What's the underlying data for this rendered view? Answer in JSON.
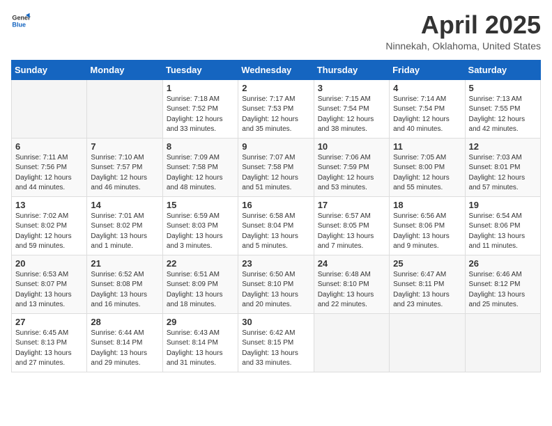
{
  "logo": {
    "general": "General",
    "blue": "Blue"
  },
  "title": "April 2025",
  "subtitle": "Ninnekah, Oklahoma, United States",
  "days_of_week": [
    "Sunday",
    "Monday",
    "Tuesday",
    "Wednesday",
    "Thursday",
    "Friday",
    "Saturday"
  ],
  "weeks": [
    [
      {
        "day": "",
        "info": ""
      },
      {
        "day": "",
        "info": ""
      },
      {
        "day": "1",
        "info": "Sunrise: 7:18 AM\nSunset: 7:52 PM\nDaylight: 12 hours and 33 minutes."
      },
      {
        "day": "2",
        "info": "Sunrise: 7:17 AM\nSunset: 7:53 PM\nDaylight: 12 hours and 35 minutes."
      },
      {
        "day": "3",
        "info": "Sunrise: 7:15 AM\nSunset: 7:54 PM\nDaylight: 12 hours and 38 minutes."
      },
      {
        "day": "4",
        "info": "Sunrise: 7:14 AM\nSunset: 7:54 PM\nDaylight: 12 hours and 40 minutes."
      },
      {
        "day": "5",
        "info": "Sunrise: 7:13 AM\nSunset: 7:55 PM\nDaylight: 12 hours and 42 minutes."
      }
    ],
    [
      {
        "day": "6",
        "info": "Sunrise: 7:11 AM\nSunset: 7:56 PM\nDaylight: 12 hours and 44 minutes."
      },
      {
        "day": "7",
        "info": "Sunrise: 7:10 AM\nSunset: 7:57 PM\nDaylight: 12 hours and 46 minutes."
      },
      {
        "day": "8",
        "info": "Sunrise: 7:09 AM\nSunset: 7:58 PM\nDaylight: 12 hours and 48 minutes."
      },
      {
        "day": "9",
        "info": "Sunrise: 7:07 AM\nSunset: 7:58 PM\nDaylight: 12 hours and 51 minutes."
      },
      {
        "day": "10",
        "info": "Sunrise: 7:06 AM\nSunset: 7:59 PM\nDaylight: 12 hours and 53 minutes."
      },
      {
        "day": "11",
        "info": "Sunrise: 7:05 AM\nSunset: 8:00 PM\nDaylight: 12 hours and 55 minutes."
      },
      {
        "day": "12",
        "info": "Sunrise: 7:03 AM\nSunset: 8:01 PM\nDaylight: 12 hours and 57 minutes."
      }
    ],
    [
      {
        "day": "13",
        "info": "Sunrise: 7:02 AM\nSunset: 8:02 PM\nDaylight: 12 hours and 59 minutes."
      },
      {
        "day": "14",
        "info": "Sunrise: 7:01 AM\nSunset: 8:02 PM\nDaylight: 13 hours and 1 minute."
      },
      {
        "day": "15",
        "info": "Sunrise: 6:59 AM\nSunset: 8:03 PM\nDaylight: 13 hours and 3 minutes."
      },
      {
        "day": "16",
        "info": "Sunrise: 6:58 AM\nSunset: 8:04 PM\nDaylight: 13 hours and 5 minutes."
      },
      {
        "day": "17",
        "info": "Sunrise: 6:57 AM\nSunset: 8:05 PM\nDaylight: 13 hours and 7 minutes."
      },
      {
        "day": "18",
        "info": "Sunrise: 6:56 AM\nSunset: 8:06 PM\nDaylight: 13 hours and 9 minutes."
      },
      {
        "day": "19",
        "info": "Sunrise: 6:54 AM\nSunset: 8:06 PM\nDaylight: 13 hours and 11 minutes."
      }
    ],
    [
      {
        "day": "20",
        "info": "Sunrise: 6:53 AM\nSunset: 8:07 PM\nDaylight: 13 hours and 13 minutes."
      },
      {
        "day": "21",
        "info": "Sunrise: 6:52 AM\nSunset: 8:08 PM\nDaylight: 13 hours and 16 minutes."
      },
      {
        "day": "22",
        "info": "Sunrise: 6:51 AM\nSunset: 8:09 PM\nDaylight: 13 hours and 18 minutes."
      },
      {
        "day": "23",
        "info": "Sunrise: 6:50 AM\nSunset: 8:10 PM\nDaylight: 13 hours and 20 minutes."
      },
      {
        "day": "24",
        "info": "Sunrise: 6:48 AM\nSunset: 8:10 PM\nDaylight: 13 hours and 22 minutes."
      },
      {
        "day": "25",
        "info": "Sunrise: 6:47 AM\nSunset: 8:11 PM\nDaylight: 13 hours and 23 minutes."
      },
      {
        "day": "26",
        "info": "Sunrise: 6:46 AM\nSunset: 8:12 PM\nDaylight: 13 hours and 25 minutes."
      }
    ],
    [
      {
        "day": "27",
        "info": "Sunrise: 6:45 AM\nSunset: 8:13 PM\nDaylight: 13 hours and 27 minutes."
      },
      {
        "day": "28",
        "info": "Sunrise: 6:44 AM\nSunset: 8:14 PM\nDaylight: 13 hours and 29 minutes."
      },
      {
        "day": "29",
        "info": "Sunrise: 6:43 AM\nSunset: 8:14 PM\nDaylight: 13 hours and 31 minutes."
      },
      {
        "day": "30",
        "info": "Sunrise: 6:42 AM\nSunset: 8:15 PM\nDaylight: 13 hours and 33 minutes."
      },
      {
        "day": "",
        "info": ""
      },
      {
        "day": "",
        "info": ""
      },
      {
        "day": "",
        "info": ""
      }
    ]
  ]
}
